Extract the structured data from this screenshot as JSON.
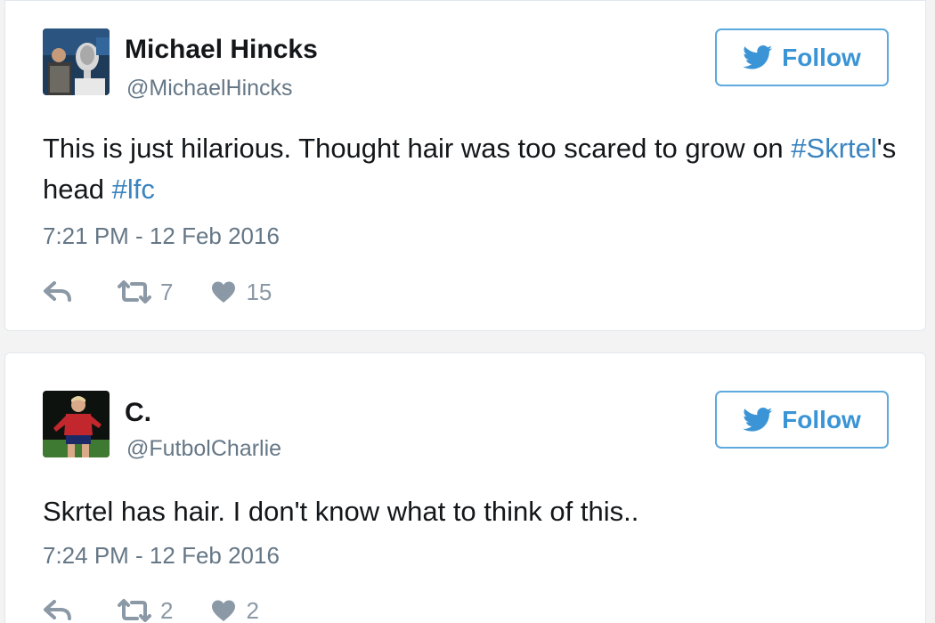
{
  "tweets": [
    {
      "display_name": "Michael Hincks",
      "handle": "@MichaelHincks",
      "follow_label": "Follow",
      "text_parts": {
        "p1": "This is just hilarious. Thought hair was too scared to grow on ",
        "tag1": "#Skrtel",
        "p2": "'s head ",
        "tag2": "#lfc"
      },
      "timestamp": "7:21 PM - 12 Feb 2016",
      "retweets": "7",
      "likes": "15",
      "avatar_icon": "trophy-photo-avatar"
    },
    {
      "display_name": "C.",
      "handle": "@FutbolCharlie",
      "follow_label": "Follow",
      "text": "Skrtel has hair. I don't know what to think of this..",
      "timestamp": "7:24 PM - 12 Feb 2016",
      "retweets": "2",
      "likes": "2",
      "avatar_icon": "footballer-photo-avatar"
    }
  ],
  "icons": {
    "follow": "twitter-bird-icon",
    "reply": "reply-icon",
    "retweet": "retweet-icon",
    "like": "heart-icon"
  },
  "colors": {
    "accent": "#3a94d6",
    "hashtag": "#3a84c0",
    "meta_text": "#657786",
    "action_gray": "#8b98a5"
  }
}
